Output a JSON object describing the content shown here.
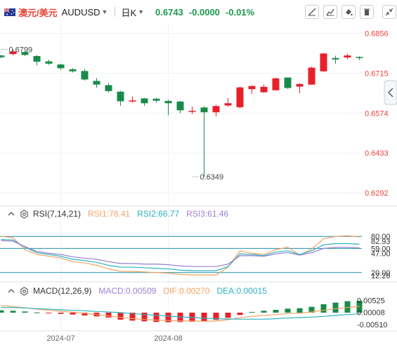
{
  "header": {
    "pair_name": "澳元/美元",
    "symbol": "AUDUSD",
    "period": "日K",
    "price": "0.6743",
    "change": "-0.0000",
    "change_pct": "-0.01%"
  },
  "toolbar_icons": [
    "draw-line-icon",
    "cursor-mode-icon",
    "fill-icon",
    "delete-icon",
    "collapse-icon",
    "fullscreen-icon"
  ],
  "colors": {
    "up": "#e8202a",
    "down": "#1a8a4a",
    "rsi1": "#f4a261",
    "rsi2": "#2bb3c0",
    "rsi3": "#9a7fd1",
    "macd_line": "#9a7fd1",
    "dif": "#f4a261",
    "dea": "#2bb3c0",
    "price_label": "#e8443a"
  },
  "rsi": {
    "name": "RSI(7,14,21)",
    "rsi1": "RSI1:78.41",
    "rsi2": "RSI2:66.77",
    "rsi3": "RSI3:61.46"
  },
  "macd": {
    "name": "MACD(12,26,9)",
    "macd": "MACD:0.00509",
    "dif": "DIF:0.00270",
    "dea": "DEA:0.00015"
  },
  "chart_data": {
    "type": "candlestick",
    "ylim": [
      0.625,
      0.689
    ],
    "y_ticks": [
      {
        "value": 0.6856,
        "label": "0.6856"
      },
      {
        "value": 0.6715,
        "label": "0.6715"
      },
      {
        "value": 0.6574,
        "label": "0.6574"
      },
      {
        "value": 0.6433,
        "label": "0.6433"
      },
      {
        "value": 0.6292,
        "label": "0.6292"
      }
    ],
    "annotations": [
      {
        "label": "0.6799",
        "index": 0,
        "value": 0.6799
      },
      {
        "label": "0.6349",
        "index": 16,
        "value": 0.6349
      }
    ],
    "candles": [
      {
        "o": 0.6778,
        "c": 0.6772,
        "h": 0.678,
        "l": 0.6768
      },
      {
        "o": 0.6783,
        "c": 0.6792,
        "h": 0.6799,
        "l": 0.6778
      },
      {
        "o": 0.679,
        "c": 0.678,
        "h": 0.6794,
        "l": 0.6776
      },
      {
        "o": 0.6776,
        "c": 0.6756,
        "h": 0.6779,
        "l": 0.6743
      },
      {
        "o": 0.6757,
        "c": 0.6749,
        "h": 0.6763,
        "l": 0.6745
      },
      {
        "o": 0.6746,
        "c": 0.6733,
        "h": 0.6749,
        "l": 0.6727
      },
      {
        "o": 0.6729,
        "c": 0.6722,
        "h": 0.6733,
        "l": 0.6718
      },
      {
        "o": 0.6723,
        "c": 0.6693,
        "h": 0.673,
        "l": 0.6689
      },
      {
        "o": 0.6688,
        "c": 0.6675,
        "h": 0.6698,
        "l": 0.6664
      },
      {
        "o": 0.6673,
        "c": 0.6652,
        "h": 0.6679,
        "l": 0.6647
      },
      {
        "o": 0.665,
        "c": 0.6616,
        "h": 0.6653,
        "l": 0.66
      },
      {
        "o": 0.6615,
        "c": 0.6619,
        "h": 0.6633,
        "l": 0.6612
      },
      {
        "o": 0.6626,
        "c": 0.6609,
        "h": 0.6628,
        "l": 0.66
      },
      {
        "o": 0.6625,
        "c": 0.6618,
        "h": 0.6628,
        "l": 0.6611
      },
      {
        "o": 0.6617,
        "c": 0.6609,
        "h": 0.6621,
        "l": 0.6567
      },
      {
        "o": 0.6615,
        "c": 0.6584,
        "h": 0.6617,
        "l": 0.6574
      },
      {
        "o": 0.658,
        "c": 0.6582,
        "h": 0.6597,
        "l": 0.6571
      },
      {
        "o": 0.6594,
        "c": 0.6577,
        "h": 0.6598,
        "l": 0.6349
      },
      {
        "o": 0.6577,
        "c": 0.6599,
        "h": 0.6603,
        "l": 0.6562
      },
      {
        "o": 0.6601,
        "c": 0.6609,
        "h": 0.6627,
        "l": 0.6597
      },
      {
        "o": 0.6595,
        "c": 0.6665,
        "h": 0.6667,
        "l": 0.6591
      },
      {
        "o": 0.6659,
        "c": 0.667,
        "h": 0.6672,
        "l": 0.6643
      },
      {
        "o": 0.6648,
        "c": 0.6667,
        "h": 0.6675,
        "l": 0.6645
      },
      {
        "o": 0.6655,
        "c": 0.6697,
        "h": 0.67,
        "l": 0.6654
      },
      {
        "o": 0.67,
        "c": 0.6663,
        "h": 0.67,
        "l": 0.666
      },
      {
        "o": 0.6668,
        "c": 0.6677,
        "h": 0.668,
        "l": 0.6645
      },
      {
        "o": 0.6675,
        "c": 0.6735,
        "h": 0.6738,
        "l": 0.6674
      },
      {
        "o": 0.6722,
        "c": 0.6785,
        "h": 0.6787,
        "l": 0.672
      },
      {
        "o": 0.6769,
        "c": 0.6764,
        "h": 0.6777,
        "l": 0.6748
      },
      {
        "o": 0.6771,
        "c": 0.6778,
        "h": 0.6784,
        "l": 0.6766
      },
      {
        "o": 0.6773,
        "c": 0.6771,
        "h": 0.6775,
        "l": 0.6762
      }
    ],
    "rsi_axis": {
      "range": [
        0,
        100
      ],
      "ticks": [
        {
          "value": 80,
          "label": "80.00"
        },
        {
          "value": 72,
          "label": "82.93"
        },
        {
          "value": 60,
          "label": "59.00"
        },
        {
          "value": 52,
          "label": "47.00"
        },
        {
          "value": 20,
          "label": "20.00"
        },
        {
          "value": 15,
          "label": "12.26"
        }
      ],
      "ref_lines": [
        80,
        60,
        20
      ]
    },
    "rsi_series": [
      {
        "name": "RSI1",
        "values": [
          80,
          78,
          58,
          50,
          47,
          44,
          38,
          36,
          32,
          26,
          22,
          22,
          21,
          20,
          19,
          17,
          16,
          16,
          16,
          29,
          56,
          52,
          50,
          58,
          62,
          49,
          59,
          76,
          80,
          81,
          79
        ]
      },
      {
        "name": "RSI2",
        "values": [
          75,
          74,
          62,
          53,
          50,
          47,
          42,
          40,
          37,
          32,
          29,
          29,
          28,
          27,
          26,
          24,
          23,
          23,
          23,
          30,
          51,
          50,
          48,
          54,
          56,
          50,
          56,
          66,
          68,
          68,
          67
        ]
      },
      {
        "name": "RSI3",
        "values": [
          73,
          72,
          63,
          55,
          52,
          50,
          46,
          44,
          42,
          38,
          35,
          35,
          34,
          34,
          33,
          31,
          30,
          30,
          30,
          34,
          48,
          48,
          47,
          51,
          53,
          49,
          53,
          60,
          62,
          62,
          61
        ]
      }
    ],
    "macd_axis": {
      "range": [
        -0.0072,
        0.0072
      ],
      "ticks": [
        {
          "value": 0.00525,
          "label": "0.00525"
        },
        {
          "value": 8e-05,
          "label": "0.00008"
        },
        {
          "value": -0.0051,
          "label": "-0.00510"
        }
      ]
    },
    "macd_hist": [
      0.001,
      0.0008,
      0.0005,
      0.0001,
      -0.0002,
      -0.0005,
      -0.0008,
      -0.0012,
      -0.0016,
      -0.0021,
      -0.003,
      -0.0034,
      -0.0037,
      -0.004,
      -0.0041,
      -0.004,
      -0.0039,
      -0.0037,
      -0.0031,
      -0.0022,
      -0.001,
      0.0003,
      0.0008,
      0.0012,
      0.0017,
      0.0019,
      0.0025,
      0.0036,
      0.0043,
      0.0049,
      0.0051
    ],
    "dif": [
      0.003,
      0.0026,
      0.0021,
      0.0015,
      0.001,
      0.0006,
      0.0002,
      -0.0003,
      -0.0008,
      -0.0014,
      -0.002,
      -0.0025,
      -0.0029,
      -0.0032,
      -0.0034,
      -0.0035,
      -0.0036,
      -0.0037,
      -0.0036,
      -0.003,
      -0.0022,
      -0.0016,
      -0.0012,
      -0.0008,
      -0.0004,
      -0.0002,
      0.0003,
      0.001,
      0.0017,
      0.0022,
      0.0027
    ],
    "dea": [
      0.0022,
      0.0022,
      0.002,
      0.0017,
      0.0015,
      0.0012,
      0.001,
      0.0008,
      0.0005,
      0.0003,
      0.0,
      -0.0004,
      -0.0008,
      -0.0011,
      -0.0015,
      -0.0018,
      -0.0021,
      -0.0024,
      -0.0026,
      -0.0027,
      -0.0028,
      -0.0028,
      -0.0028,
      -0.0026,
      -0.0023,
      -0.0021,
      -0.0019,
      -0.0016,
      -0.0012,
      -0.0008,
      -0.0005
    ],
    "x_labels": [
      {
        "label": "2024-07",
        "index": 5
      },
      {
        "label": "2024-08",
        "index": 14
      }
    ]
  }
}
